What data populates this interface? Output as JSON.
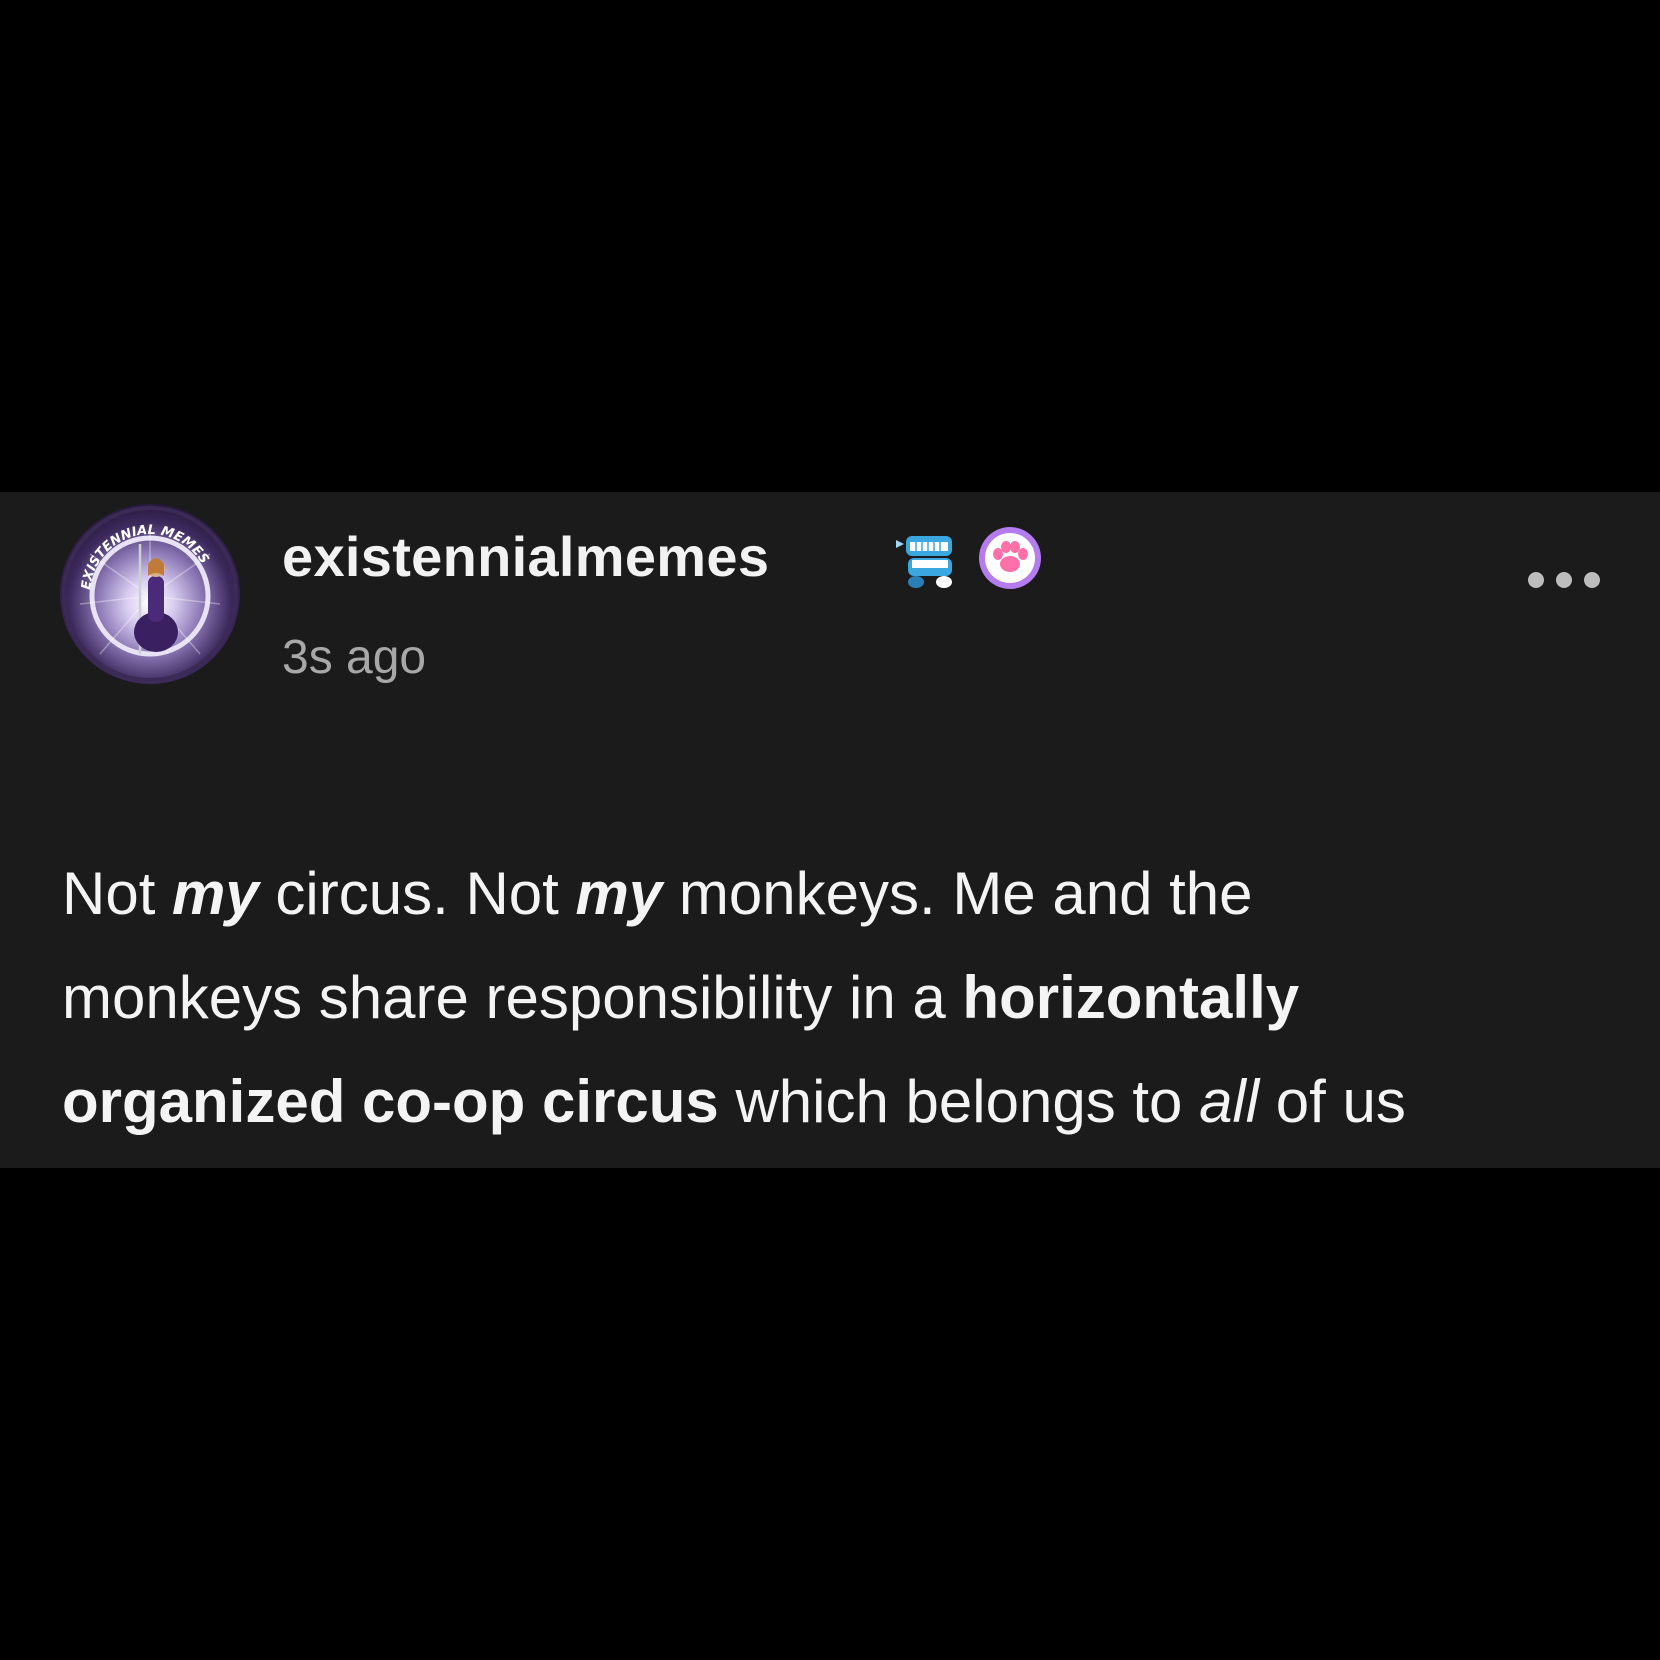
{
  "post": {
    "avatar_icon": "circular-avatar-existennialmemes-logo",
    "avatar_ring_text": "EXISTENNIAL MEMES",
    "username": "existennialmemes",
    "badges": [
      "chattering-teeth-icon",
      "paw-print-icon"
    ],
    "timestamp": "3s ago",
    "more_icon": "ellipsis-icon",
    "body": {
      "line1": {
        "t1": "Not ",
        "t2": "my",
        "t3": " circus. Not ",
        "t4": "my",
        "t5": " monkeys. Me and the"
      },
      "line2": {
        "t1": "monkeys share responsibility in a ",
        "t2": "horizontally"
      },
      "line3": {
        "t1": "organized co-op circus",
        "t2": " which belongs to ",
        "t3": "all",
        "t4": " of us"
      }
    }
  },
  "colors": {
    "page_background": "#000000",
    "card_background": "#1b1b1c",
    "text_primary": "#f4f4f4",
    "text_secondary": "#a8a8a8",
    "paw_badge_purple": "#b57cf0",
    "teeth_badge_blue": "#3aa7e0"
  }
}
